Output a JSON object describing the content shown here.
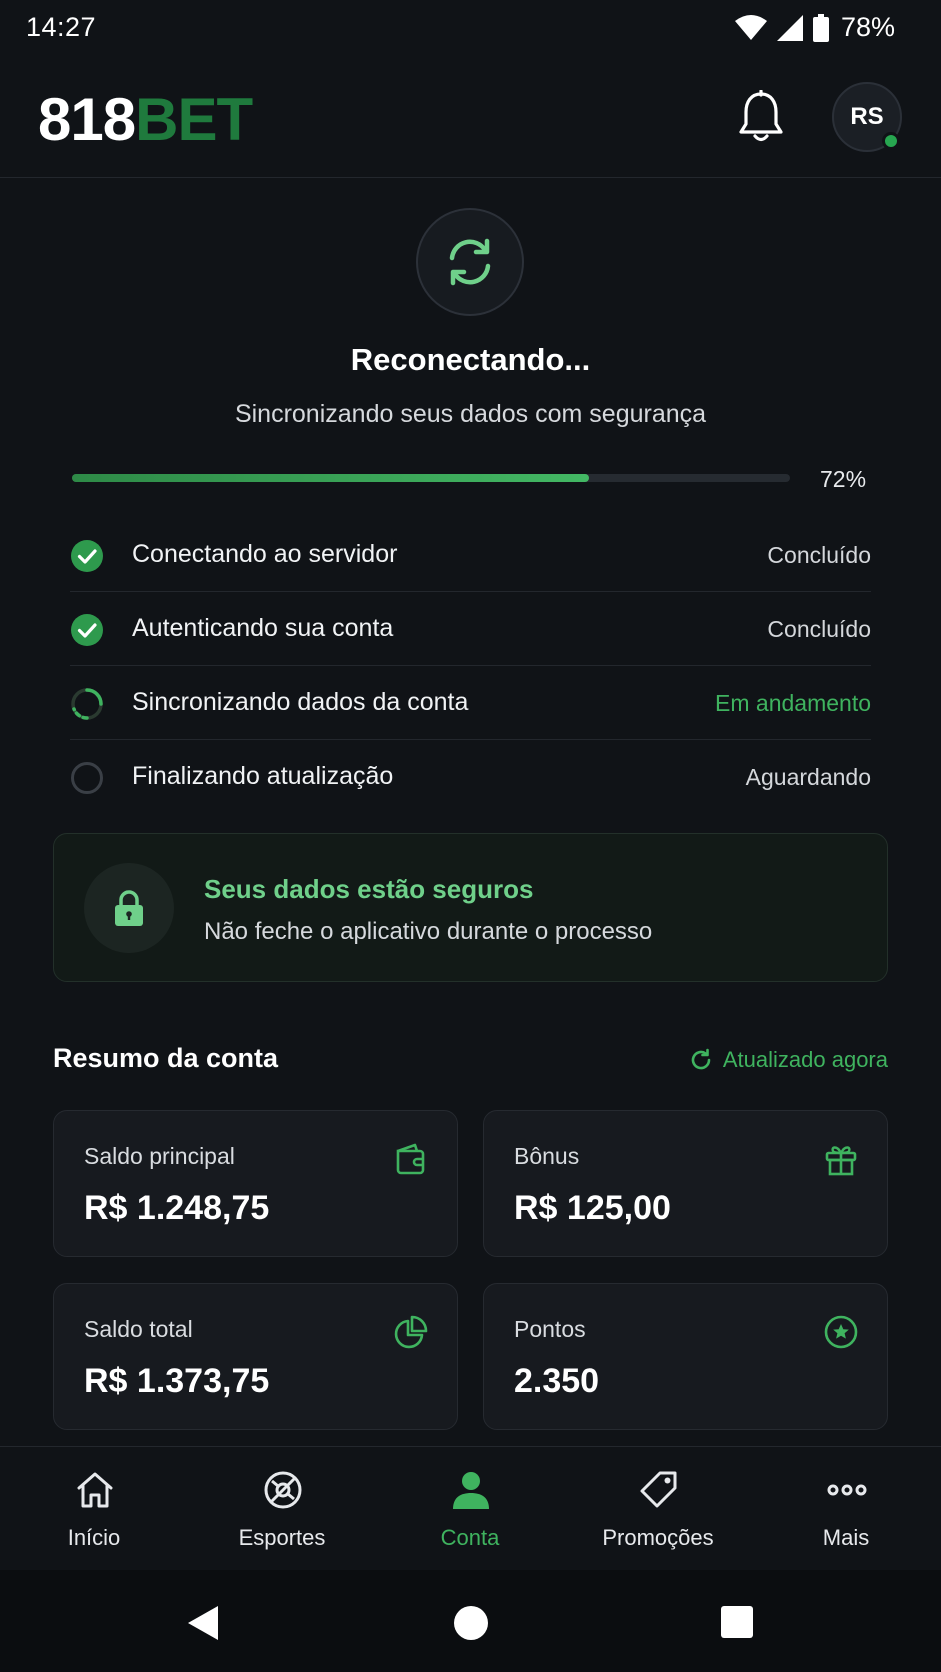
{
  "status_bar": {
    "time": "14:27",
    "battery": "78%"
  },
  "header": {
    "logo_white": "818",
    "logo_green": "BET",
    "avatar_initials": "RS"
  },
  "reconnect": {
    "title": "Reconectando...",
    "subtitle": "Sincronizando seus dados com segurança",
    "progress": 0.72,
    "progress_label": "72%",
    "steps": [
      {
        "label": "Conectando ao servidor",
        "status": "Concluído",
        "state": "done"
      },
      {
        "label": "Autenticando sua conta",
        "status": "Concluído",
        "state": "done"
      },
      {
        "label": "Sincronizando dados da conta",
        "status": "Em andamento",
        "state": "in-progress"
      },
      {
        "label": "Finalizando atualização",
        "status": "Aguardando",
        "state": "pending"
      }
    ]
  },
  "secure_notice": {
    "title": "Seus dados estão seguros",
    "text": "Não feche o aplicativo durante o processo",
    "icon": "lock-icon"
  },
  "summary": {
    "title": "Resumo da conta",
    "updated": "Atualizado agora",
    "cards": [
      {
        "label": "Saldo principal",
        "value": "R$ 1.248,75",
        "icon": "wallet-icon"
      },
      {
        "label": "Bônus",
        "value": "R$ 125,00",
        "icon": "gift-icon"
      },
      {
        "label": "Saldo total",
        "value": "R$ 1.373,75",
        "icon": "pie-chart-icon"
      },
      {
        "label": "Pontos",
        "value": "2.350",
        "icon": "star-badge-icon"
      }
    ]
  },
  "bottom_nav": [
    {
      "label": "Início",
      "icon": "home-icon",
      "active": false
    },
    {
      "label": "Esportes",
      "icon": "sports-ball-icon",
      "active": false
    },
    {
      "label": "Conta",
      "icon": "user-icon",
      "active": true
    },
    {
      "label": "Promoções",
      "icon": "tag-icon",
      "active": false
    },
    {
      "label": "Mais",
      "icon": "more-icon",
      "active": false
    }
  ],
  "colors": {
    "accent": "#3fb35f",
    "brand_green": "#1f7a3d",
    "background": "#101317",
    "card": "#171a1f"
  }
}
